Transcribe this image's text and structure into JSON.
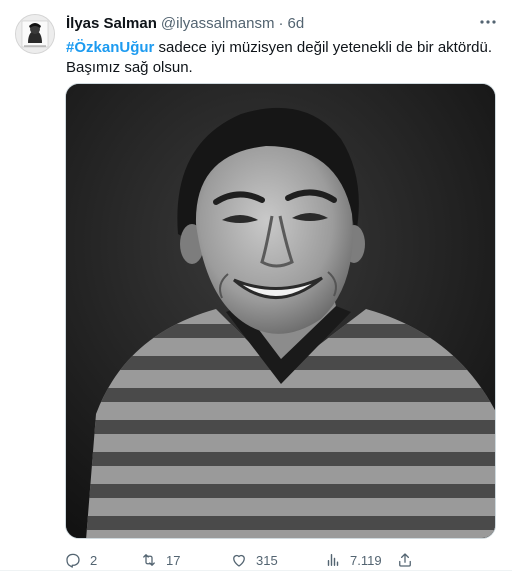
{
  "tweet": {
    "author": {
      "display_name": "İlyas Salman",
      "handle": "@ilyassalmansm",
      "time": "6d"
    },
    "text": {
      "hashtag": "#ÖzkanUğur",
      "body": " sadece iyi müzisyen değil yetenekli de bir aktördü. Başımız sağ olsun."
    },
    "media": {
      "type": "photo",
      "style": "black-and-white portrait"
    },
    "actions": {
      "replies": "2",
      "retweets": "17",
      "likes": "315",
      "views": "7.119"
    },
    "colors": {
      "accent": "#1d9bf0",
      "secondary_text": "#536471",
      "primary_text": "#0f1419"
    },
    "icons": [
      "more-icon",
      "reply-icon",
      "retweet-icon",
      "like-icon",
      "views-icon",
      "share-icon"
    ]
  }
}
